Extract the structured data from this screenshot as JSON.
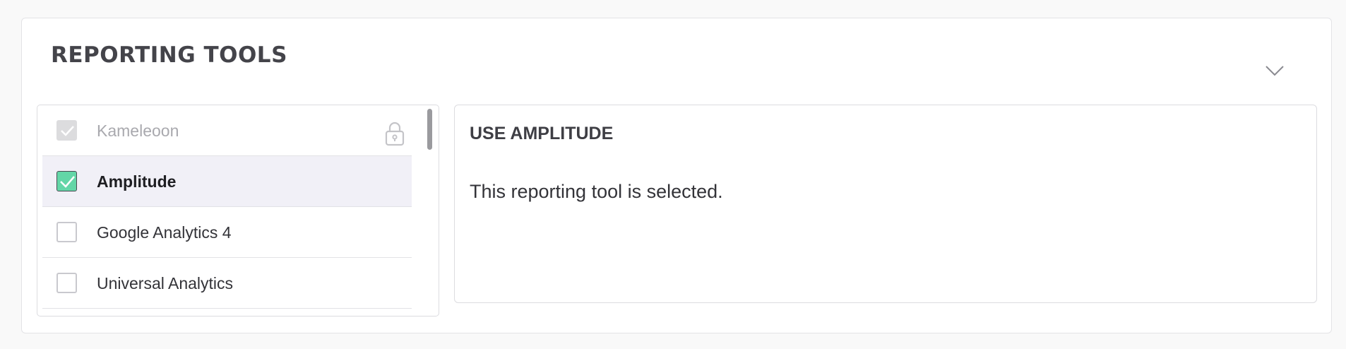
{
  "section": {
    "title": "REPORTING TOOLS",
    "toggle_icon": "chevron-down-icon"
  },
  "tools": {
    "items": [
      {
        "label": "Kameleoon",
        "state": "checked-disabled",
        "locked": true
      },
      {
        "label": "Amplitude",
        "state": "checked",
        "selected": true
      },
      {
        "label": "Google Analytics 4",
        "state": "unchecked"
      },
      {
        "label": "Universal Analytics",
        "state": "unchecked"
      }
    ]
  },
  "detail": {
    "title": "USE AMPLITUDE",
    "text": "This reporting tool is selected."
  },
  "colors": {
    "accent_green": "#63d6a7",
    "selected_row": "#f1f0f7",
    "title_text": "#44444a"
  }
}
